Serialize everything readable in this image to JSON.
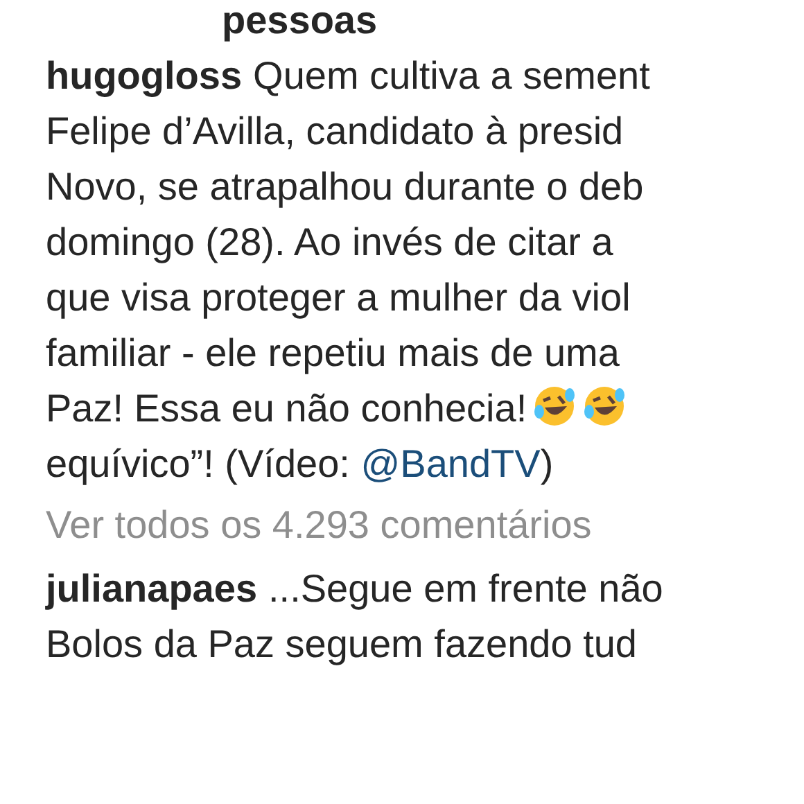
{
  "likes_fragment": "pessoas",
  "caption": {
    "username": "hugogloss",
    "lines": [
      {
        "kind": "text",
        "text": "Quem cultiva a sement"
      },
      {
        "kind": "text",
        "text": "Felipe d’Avilla, candidato à presid"
      },
      {
        "kind": "text",
        "text": "Novo, se atrapalhou durante o deb"
      },
      {
        "kind": "text",
        "text": "domingo (28). Ao invés de citar a"
      },
      {
        "kind": "text",
        "text": "que visa proteger a mulher da viol"
      },
      {
        "kind": "text",
        "text": "familiar - ele repetiu mais de uma"
      },
      {
        "kind": "emoji",
        "text": "Paz! Essa eu não conhecia!"
      },
      {
        "kind": "link",
        "text": "equívico”! (Vídeo: ",
        "link": "@BandTV",
        "after": ")"
      }
    ]
  },
  "view_all": "Ver todos os 4.293 comentários",
  "comment": {
    "username": "julianapaes",
    "lines": [
      "...Segue em frente não",
      "Bolos da Paz seguem fazendo tud"
    ]
  }
}
